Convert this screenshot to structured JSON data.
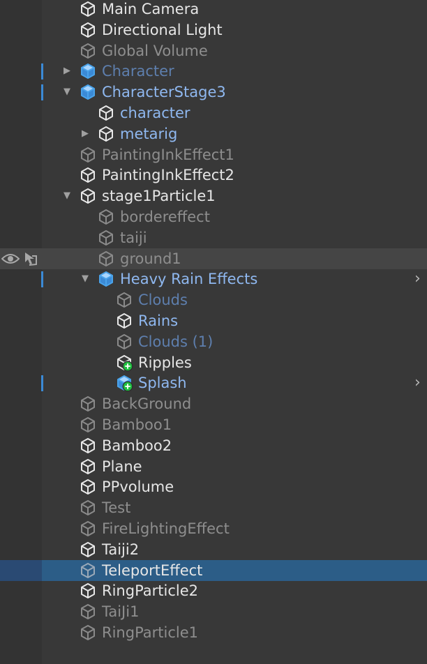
{
  "hierarchy": {
    "rows": [
      {
        "label": "Main Camera",
        "icon": "gameobject-icon",
        "state": "normal",
        "depth": 0,
        "foldout": "none",
        "bar": false
      },
      {
        "label": "Directional Light",
        "icon": "gameobject-icon",
        "state": "normal",
        "depth": 0,
        "foldout": "none",
        "bar": false
      },
      {
        "label": "Global Volume",
        "icon": "gameobject-icon",
        "state": "disabled",
        "depth": 0,
        "foldout": "none",
        "bar": false
      },
      {
        "label": "Character",
        "icon": "prefab-icon",
        "state": "prefab-disabled",
        "depth": 0,
        "foldout": "collapsed",
        "bar": true
      },
      {
        "label": "CharacterStage3",
        "icon": "prefab-icon",
        "state": "prefab",
        "depth": 0,
        "foldout": "expanded",
        "bar": true
      },
      {
        "label": "character",
        "icon": "gameobject-icon",
        "state": "prefab",
        "depth": 1,
        "foldout": "none",
        "bar": false
      },
      {
        "label": "metarig",
        "icon": "gameobject-icon",
        "state": "prefab",
        "depth": 1,
        "foldout": "collapsed",
        "bar": false
      },
      {
        "label": "PaintingInkEffect1",
        "icon": "gameobject-icon",
        "state": "disabled",
        "depth": 0,
        "foldout": "none",
        "bar": false
      },
      {
        "label": "PaintingInkEffect2",
        "icon": "gameobject-icon",
        "state": "normal",
        "depth": 0,
        "foldout": "none",
        "bar": false
      },
      {
        "label": "stage1Particle1",
        "icon": "gameobject-icon",
        "state": "normal",
        "depth": 0,
        "foldout": "expanded",
        "bar": false
      },
      {
        "label": "bordereffect",
        "icon": "gameobject-icon",
        "state": "disabled",
        "depth": 1,
        "foldout": "none",
        "bar": false
      },
      {
        "label": "taiji",
        "icon": "gameobject-icon",
        "state": "disabled",
        "depth": 1,
        "foldout": "none",
        "bar": false
      },
      {
        "label": "ground1",
        "icon": "gameobject-icon",
        "state": "disabled",
        "depth": 1,
        "foldout": "none",
        "bar": false,
        "hovered": true
      },
      {
        "label": "Heavy Rain Effects",
        "icon": "prefab-icon",
        "state": "prefab",
        "depth": 1,
        "foldout": "expanded",
        "bar": true,
        "sideArrow": true
      },
      {
        "label": "Clouds",
        "icon": "gameobject-icon",
        "state": "prefab-disabled",
        "depth": 2,
        "foldout": "none",
        "bar": false
      },
      {
        "label": "Rains",
        "icon": "gameobject-icon",
        "state": "prefab",
        "depth": 2,
        "foldout": "none",
        "bar": false
      },
      {
        "label": "Clouds (1)",
        "icon": "gameobject-icon",
        "state": "prefab-disabled",
        "depth": 2,
        "foldout": "none",
        "bar": false
      },
      {
        "label": "Ripples",
        "icon": "added-gameobject-icon",
        "state": "normal",
        "depth": 2,
        "foldout": "none",
        "bar": false
      },
      {
        "label": "Splash",
        "icon": "added-prefab-icon",
        "state": "prefab",
        "depth": 2,
        "foldout": "none",
        "bar": true,
        "sideArrow": true
      },
      {
        "label": "BackGround",
        "icon": "gameobject-icon",
        "state": "disabled",
        "depth": 0,
        "foldout": "none",
        "bar": false
      },
      {
        "label": "Bamboo1",
        "icon": "gameobject-icon",
        "state": "disabled",
        "depth": 0,
        "foldout": "none",
        "bar": false
      },
      {
        "label": "Bamboo2",
        "icon": "gameobject-icon",
        "state": "normal",
        "depth": 0,
        "foldout": "none",
        "bar": false
      },
      {
        "label": "Plane",
        "icon": "gameobject-icon",
        "state": "normal",
        "depth": 0,
        "foldout": "none",
        "bar": false
      },
      {
        "label": "PPvolume",
        "icon": "gameobject-icon",
        "state": "normal",
        "depth": 0,
        "foldout": "none",
        "bar": false
      },
      {
        "label": "Test",
        "icon": "gameobject-icon",
        "state": "disabled",
        "depth": 0,
        "foldout": "none",
        "bar": false
      },
      {
        "label": "FireLightingEffect",
        "icon": "gameobject-icon",
        "state": "disabled",
        "depth": 0,
        "foldout": "none",
        "bar": false
      },
      {
        "label": "Taiji2",
        "icon": "gameobject-icon",
        "state": "normal",
        "depth": 0,
        "foldout": "none",
        "bar": false
      },
      {
        "label": "TeleportEffect",
        "icon": "gameobject-icon",
        "state": "selected",
        "depth": 0,
        "foldout": "none",
        "bar": false,
        "selected": true
      },
      {
        "label": "RingParticle2",
        "icon": "gameobject-icon",
        "state": "normal",
        "depth": 0,
        "foldout": "none",
        "bar": false
      },
      {
        "label": "TaiJi1",
        "icon": "gameobject-icon",
        "state": "disabled",
        "depth": 0,
        "foldout": "none",
        "bar": false
      },
      {
        "label": "RingParticle1",
        "icon": "gameobject-icon",
        "state": "disabled",
        "depth": 0,
        "foldout": "none",
        "bar": false
      }
    ],
    "hover_icons": {
      "visibility": "eye-icon",
      "pickability": "hand-pointer-icon"
    },
    "colors": {
      "background": "#383838",
      "normal_text": "#e6e6e6",
      "disabled_text": "#8e8e8e",
      "prefab_text": "#8fb8f0",
      "prefab_disabled_text": "#5e7fae",
      "selection": "#2c5d87",
      "prefab_bar": "#3b8ad6",
      "added_badge": "#1fbf3f"
    }
  }
}
